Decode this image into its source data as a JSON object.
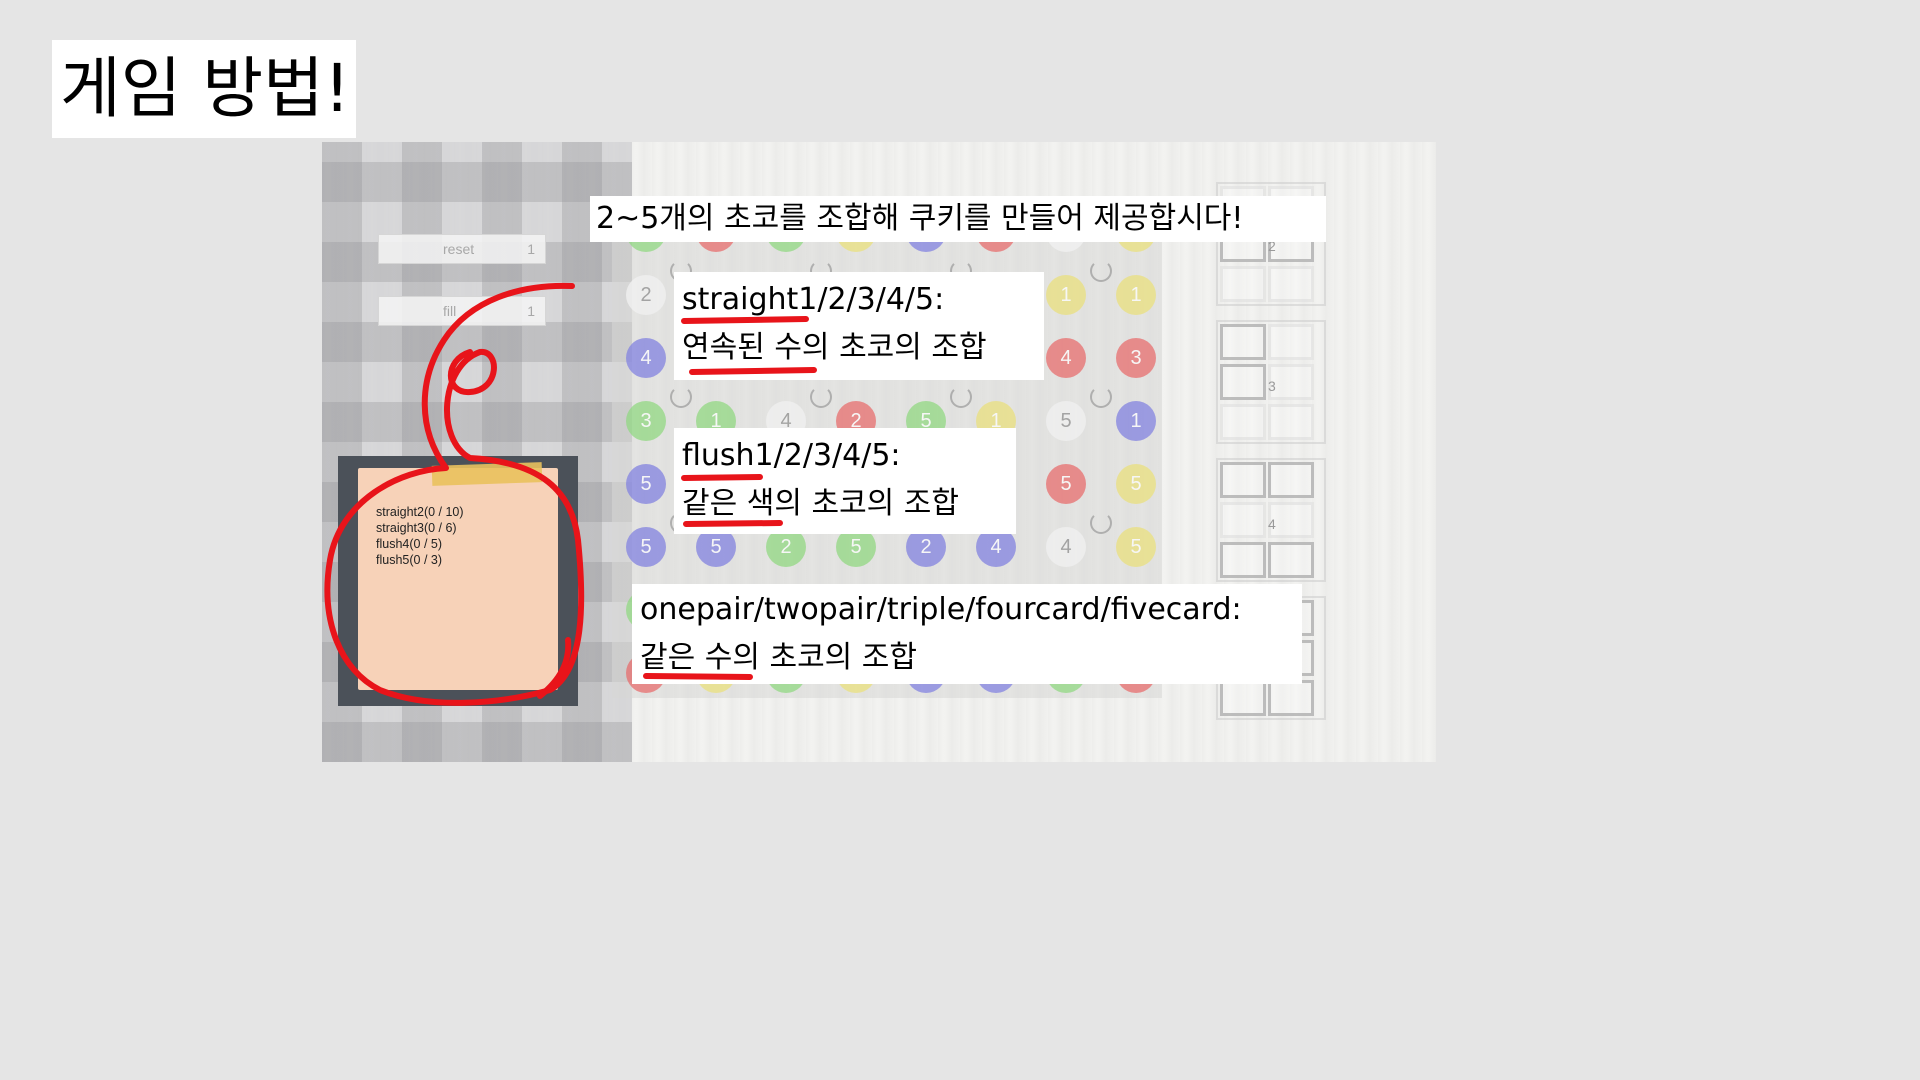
{
  "slide": {
    "title": "게임 방법!"
  },
  "game": {
    "controls": [
      {
        "label": "reset",
        "value": "1"
      },
      {
        "label": "fill",
        "value": "1"
      }
    ],
    "missions": [
      "straight2(0 / 10)",
      "straight3(0 / 6)",
      "flush4(0 / 5)",
      "flush5(0 / 3)"
    ],
    "orb_colors": {
      "green": "#8fd87f",
      "red": "#e86a6a",
      "blue": "#7f7fe0",
      "yellow": "#eae07a",
      "white": "#f2f2f2"
    },
    "board_rows": [
      [
        {
          "num": "",
          "color": "green"
        },
        {
          "num": "",
          "color": "red"
        },
        {
          "num": "",
          "color": "green"
        },
        {
          "num": "",
          "color": "yellow"
        },
        {
          "num": "",
          "color": "blue"
        },
        {
          "num": "",
          "color": "red"
        },
        {
          "num": "",
          "color": "white"
        },
        {
          "num": "",
          "color": "yellow"
        }
      ],
      [
        {
          "num": "2",
          "color": "white"
        },
        {
          "num": "",
          "color": "white"
        },
        {
          "num": "",
          "color": "white"
        },
        {
          "num": "",
          "color": "white"
        },
        {
          "num": "",
          "color": "white"
        },
        {
          "num": "",
          "color": "white"
        },
        {
          "num": "1",
          "color": "yellow"
        },
        {
          "num": "1",
          "color": "yellow"
        }
      ],
      [
        {
          "num": "4",
          "color": "blue"
        },
        {
          "num": "",
          "color": "white"
        },
        {
          "num": "",
          "color": "white"
        },
        {
          "num": "",
          "color": "white"
        },
        {
          "num": "",
          "color": "white"
        },
        {
          "num": "",
          "color": "white"
        },
        {
          "num": "4",
          "color": "red"
        },
        {
          "num": "3",
          "color": "red"
        }
      ],
      [
        {
          "num": "3",
          "color": "green"
        },
        {
          "num": "1",
          "color": "green"
        },
        {
          "num": "4",
          "color": "white"
        },
        {
          "num": "2",
          "color": "red"
        },
        {
          "num": "5",
          "color": "green"
        },
        {
          "num": "1",
          "color": "yellow"
        },
        {
          "num": "5",
          "color": "white"
        },
        {
          "num": "1",
          "color": "blue"
        }
      ],
      [
        {
          "num": "5",
          "color": "blue"
        },
        {
          "num": "",
          "color": "white"
        },
        {
          "num": "",
          "color": "white"
        },
        {
          "num": "",
          "color": "white"
        },
        {
          "num": "",
          "color": "white"
        },
        {
          "num": "",
          "color": "white"
        },
        {
          "num": "5",
          "color": "red"
        },
        {
          "num": "5",
          "color": "yellow"
        }
      ],
      [
        {
          "num": "5",
          "color": "blue"
        },
        {
          "num": "5",
          "color": "blue"
        },
        {
          "num": "2",
          "color": "green"
        },
        {
          "num": "5",
          "color": "green"
        },
        {
          "num": "2",
          "color": "blue"
        },
        {
          "num": "4",
          "color": "blue"
        },
        {
          "num": "4",
          "color": "white"
        },
        {
          "num": "5",
          "color": "yellow"
        }
      ],
      [
        {
          "num": "",
          "color": "green"
        },
        {
          "num": "",
          "color": "white"
        },
        {
          "num": "",
          "color": "white"
        },
        {
          "num": "",
          "color": "white"
        },
        {
          "num": "",
          "color": "white"
        },
        {
          "num": "",
          "color": "white"
        },
        {
          "num": "",
          "color": "white"
        },
        {
          "num": "",
          "color": "white"
        }
      ],
      [
        {
          "num": "",
          "color": "red"
        },
        {
          "num": "",
          "color": "yellow"
        },
        {
          "num": "",
          "color": "green"
        },
        {
          "num": "",
          "color": "yellow"
        },
        {
          "num": "",
          "color": "blue"
        },
        {
          "num": "",
          "color": "blue"
        },
        {
          "num": "",
          "color": "green"
        },
        {
          "num": "",
          "color": "red"
        }
      ]
    ],
    "trays": [
      {
        "num": "2"
      },
      {
        "num": "3"
      },
      {
        "num": "4"
      },
      {
        "num": ""
      }
    ]
  },
  "annotations": {
    "intro": "2~5개의 초코를 조합해 쿠키를 만들어 제공합시다!",
    "straight_title": "straight1/2/3/4/5:",
    "straight_desc": "연속된 수의 초코의 조합",
    "flush_title": "flush1/2/3/4/5:",
    "flush_desc": "같은 색의 초코의 조합",
    "pairs_title": "onepair/twopair/triple/fourcard/fivecard:",
    "pairs_desc": "같은 수의 초코의 조합",
    "marker_color": "#e8141a"
  }
}
